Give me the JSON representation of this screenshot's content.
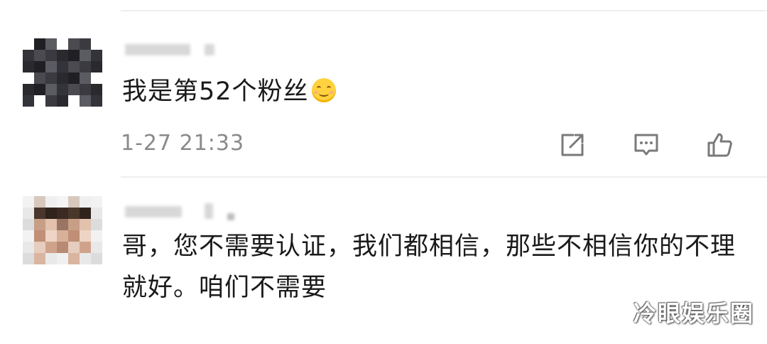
{
  "comments": [
    {
      "text": "我是第52个粉丝",
      "emoji": "smiling-face-emoji",
      "timestamp": "1-27 21:33",
      "actions": {
        "share_icon": "share-icon",
        "reply_icon": "comment-icon",
        "like_icon": "thumbs-up-icon"
      }
    },
    {
      "text": "哥，您不需要认证，我们都相信，那些不相信你的不理就好。咱们不需要"
    }
  ],
  "watermark": "冷眼娱乐圈",
  "colors": {
    "text": "#1a1a1a",
    "meta": "#8a8a8a",
    "divider": "#eeeeee",
    "icon": "#7a7a7a"
  }
}
